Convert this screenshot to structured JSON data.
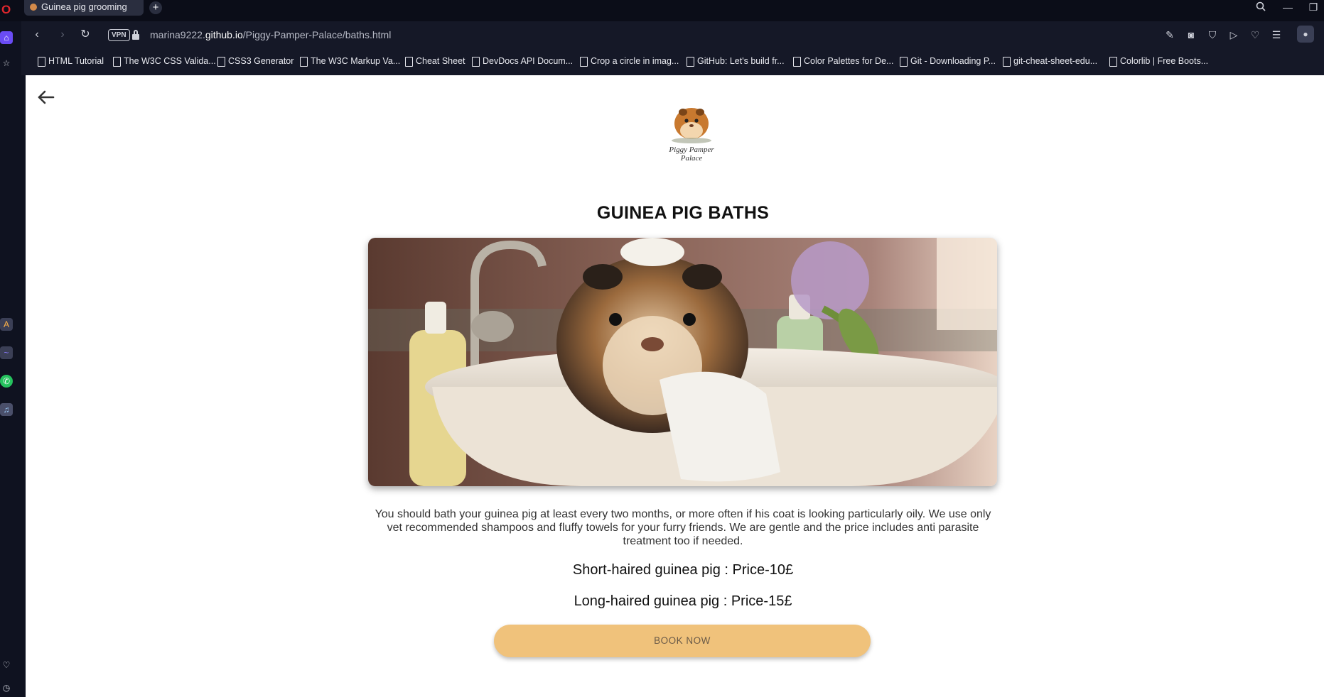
{
  "browser": {
    "tab_title": "Guinea pig grooming",
    "new_tab_label": "+",
    "vpn_label": "VPN",
    "url_prefix": "marina9222.",
    "url_host": "github.io",
    "url_path": "/Piggy-Pamper-Palace/baths.html"
  },
  "bookmarks": [
    "HTML Tutorial",
    "The W3C CSS Valida...",
    "CSS3 Generator",
    "The W3C Markup Va...",
    "Cheat Sheet",
    "DevDocs API Docum...",
    "Crop a circle in imag...",
    "GitHub: Let's build fr...",
    "Color Palettes for De...",
    "Git - Downloading P...",
    "git-cheat-sheet-edu...",
    "Colorlib | Free Boots..."
  ],
  "page": {
    "logo_text_line1": "Piggy Pamper",
    "logo_text_line2": "Palace",
    "title": "GUINEA PIG BATHS",
    "description": "You should bath your guinea pig at least every two months, or more often if his coat is looking particularly oily. We use only vet recommended shampoos and fluffy towels for your furry friends. We are gentle and the price includes anti parasite treatment too if needed.",
    "price_short": "Short-haired guinea pig : Price-10£",
    "price_long": "Long-haired guinea pig : Price-15£",
    "book_button": "BOOK NOW"
  },
  "colors": {
    "button_bg": "#f0c27b",
    "chrome_bg": "#151827",
    "accent": "#6a4cf5"
  }
}
